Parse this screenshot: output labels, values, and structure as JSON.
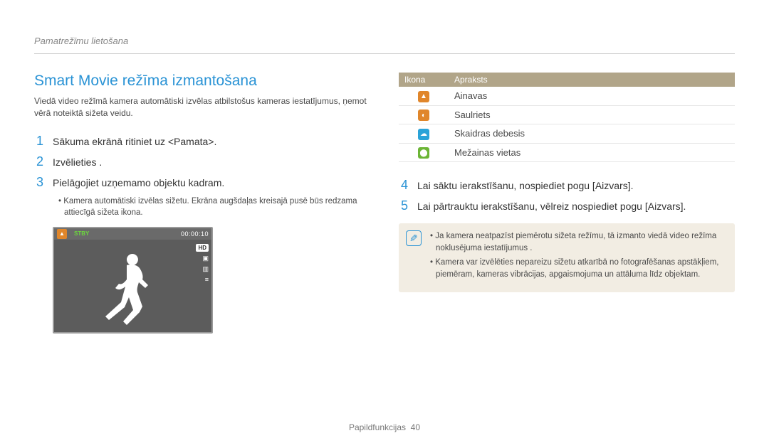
{
  "header": {
    "section": "Pamatrežīmu lietošana"
  },
  "title": "Smart Movie režīma izmantošana",
  "intro": "Viedā video režīmā kamera automātiski izvēlas atbilstošus kameras iestatījumus, ņemot vērā noteiktā sižeta veidu.",
  "steps": [
    {
      "n": "1",
      "text": "Sākuma ekrānā ritiniet uz <Pamata>."
    },
    {
      "n": "2",
      "text": "Izvēlieties       ."
    },
    {
      "n": "3",
      "text": "Pielāgojiet uzņemamo objektu kadram."
    },
    {
      "n": "4",
      "text": "Lai sāktu ierakstīšanu, nospiediet pogu [Aizvars]."
    },
    {
      "n": "5",
      "text": "Lai pārtrauktu ierakstīšanu, vēlreiz nospiediet pogu [Aizvars]."
    }
  ],
  "step3_bullet": "Kamera automātiski izvēlas sižetu. Ekrāna augšdaļas kreisajā pusē būs redzama attiecīgā sižeta ikona.",
  "preview": {
    "stby": "STBY",
    "timer": "00:00:10",
    "hd": "HD"
  },
  "icon_table": {
    "head_icon": "Ikona",
    "head_desc": "Apraksts",
    "rows": [
      {
        "label": "Ainavas"
      },
      {
        "label": "Saulriets"
      },
      {
        "label": "Skaidras debesis"
      },
      {
        "label": "Mežainas vietas"
      }
    ]
  },
  "notes": [
    "Ja kamera neatpazīst piemērotu sižeta režīmu, tā izmanto viedā video režīma noklusējuma iestatījumus .",
    "Kamera var izvēlēties nepareizu sižetu atkarībā no fotografēšanas apstākļiem, piemēram, kameras vibrācijas, apgaismojuma un attāluma līdz objektam."
  ],
  "footer": {
    "label": "Papildfunkcijas",
    "page": "40"
  }
}
